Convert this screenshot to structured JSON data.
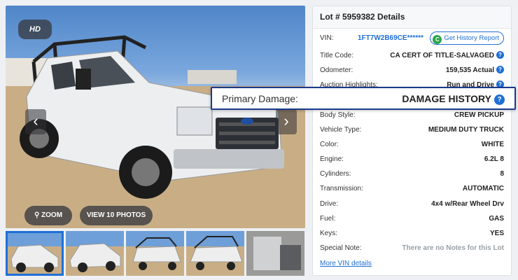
{
  "photo": {
    "hd_label": "HD",
    "zoom_label": "ZOOM",
    "view_label": "VIEW 10 PHOTOS",
    "prev_icon": "chevron-left-icon",
    "next_icon": "chevron-right-icon"
  },
  "details": {
    "title": "Lot # 5959382 Details",
    "vin_label": "VIN:",
    "vin_value": "1FT7W2B69CE******",
    "history_button": "Get History Report",
    "rows": [
      {
        "label": "Title Code:",
        "value": "CA CERT OF TITLE-SALVAGED",
        "help": true
      },
      {
        "label": "Odometer:",
        "value": "159,535 Actual",
        "help": true
      },
      {
        "label": "Auction Highlights:",
        "value": "Run and Drive",
        "help": true
      },
      {
        "label": "Primary Damage:",
        "value": "",
        "help": false
      },
      {
        "label": "Body Style:",
        "value": "CREW PICKUP",
        "help": false
      },
      {
        "label": "Vehicle Type:",
        "value": "MEDIUM DUTY TRUCK",
        "help": false
      },
      {
        "label": "Color:",
        "value": "WHITE",
        "help": false
      },
      {
        "label": "Engine:",
        "value": "6.2L 8",
        "help": false
      },
      {
        "label": "Cylinders:",
        "value": "8",
        "help": false
      },
      {
        "label": "Transmission:",
        "value": "AUTOMATIC",
        "help": false
      },
      {
        "label": "Drive:",
        "value": "4x4 w/Rear Wheel Drv",
        "help": false
      },
      {
        "label": "Fuel:",
        "value": "GAS",
        "help": false
      },
      {
        "label": "Keys:",
        "value": "YES",
        "help": false
      },
      {
        "label": "Special Note:",
        "value": "There are no Notes for this Lot",
        "help": false
      }
    ],
    "more_link": "More VIN details"
  },
  "damage_popover": {
    "label": "Primary Damage:",
    "value": "DAMAGE HISTORY"
  },
  "colors": {
    "accent": "#1f6fd6",
    "popover_border": "#1a3a8c",
    "history_icon": "#2aa64a"
  }
}
